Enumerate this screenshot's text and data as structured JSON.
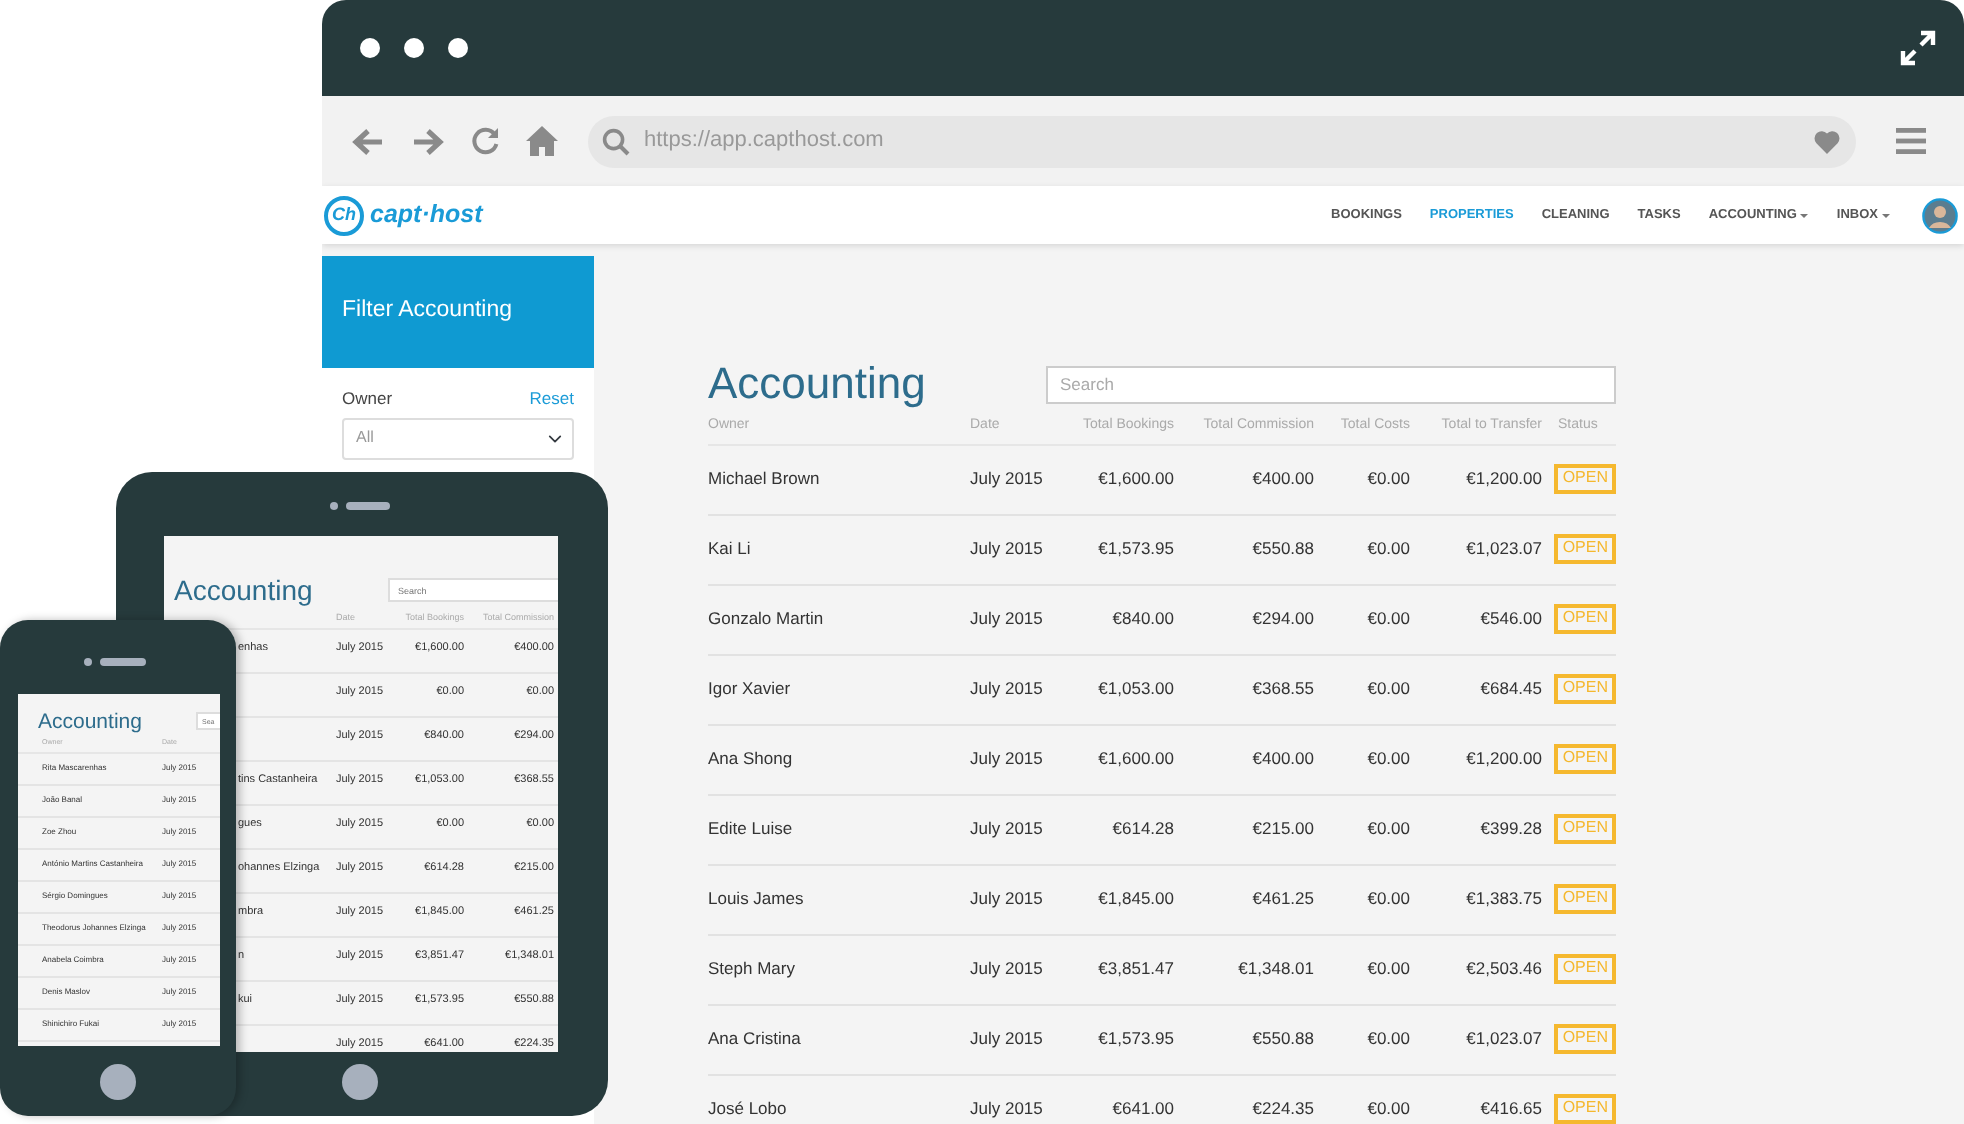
{
  "browser": {
    "url": "https://app.capthost.com"
  },
  "app": {
    "logo_mark": "Ch",
    "logo_text": "capt·host",
    "nav": [
      {
        "label": "BOOKINGS",
        "selected": false,
        "dropdown": false
      },
      {
        "label": "PROPERTIES",
        "selected": true,
        "dropdown": false
      },
      {
        "label": "CLEANING",
        "selected": false,
        "dropdown": false
      },
      {
        "label": "TASKS",
        "selected": false,
        "dropdown": false
      },
      {
        "label": "ACCOUNTING",
        "selected": false,
        "dropdown": true
      },
      {
        "label": "INBOX",
        "selected": false,
        "dropdown": true
      }
    ],
    "sidebar": {
      "title": "Filter Accounting",
      "owner_label": "Owner",
      "reset": "Reset",
      "owner_select": "All"
    },
    "page": {
      "title": "Accounting",
      "search_placeholder": "Search",
      "columns": [
        "Owner",
        "Date",
        "Total Bookings",
        "Total Commission",
        "Total Costs",
        "Total to Transfer",
        "Status"
      ],
      "rows": [
        {
          "owner": "Michael Brown",
          "date": "July 2015",
          "total_bookings": "€1,600.00",
          "total_commission": "€400.00",
          "total_costs": "€0.00",
          "total_to_transfer": "€1,200.00",
          "status": "OPEN"
        },
        {
          "owner": "Kai Li",
          "date": "July 2015",
          "total_bookings": "€1,573.95",
          "total_commission": "€550.88",
          "total_costs": "€0.00",
          "total_to_transfer": "€1,023.07",
          "status": "OPEN"
        },
        {
          "owner": "Gonzalo Martin",
          "date": "July 2015",
          "total_bookings": "€840.00",
          "total_commission": "€294.00",
          "total_costs": "€0.00",
          "total_to_transfer": "€546.00",
          "status": "OPEN"
        },
        {
          "owner": "Igor Xavier",
          "date": "July 2015",
          "total_bookings": "€1,053.00",
          "total_commission": "€368.55",
          "total_costs": "€0.00",
          "total_to_transfer": "€684.45",
          "status": "OPEN"
        },
        {
          "owner": "Ana Shong",
          "date": "July 2015",
          "total_bookings": "€1,600.00",
          "total_commission": "€400.00",
          "total_costs": "€0.00",
          "total_to_transfer": "€1,200.00",
          "status": "OPEN"
        },
        {
          "owner": "Edite Luise",
          "date": "July 2015",
          "total_bookings": "€614.28",
          "total_commission": "€215.00",
          "total_costs": "€0.00",
          "total_to_transfer": "€399.28",
          "status": "OPEN"
        },
        {
          "owner": "Louis James",
          "date": "July 2015",
          "total_bookings": "€1,845.00",
          "total_commission": "€461.25",
          "total_costs": "€0.00",
          "total_to_transfer": "€1,383.75",
          "status": "OPEN"
        },
        {
          "owner": "Steph Mary",
          "date": "July 2015",
          "total_bookings": "€3,851.47",
          "total_commission": "€1,348.01",
          "total_costs": "€0.00",
          "total_to_transfer": "€2,503.46",
          "status": "OPEN"
        },
        {
          "owner": "Ana Cristina",
          "date": "July 2015",
          "total_bookings": "€1,573.95",
          "total_commission": "€550.88",
          "total_costs": "€0.00",
          "total_to_transfer": "€1,023.07",
          "status": "OPEN"
        },
        {
          "owner": "José Lobo",
          "date": "July 2015",
          "total_bookings": "€641.00",
          "total_commission": "€224.35",
          "total_costs": "€0.00",
          "total_to_transfer": "€416.65",
          "status": "OPEN"
        }
      ]
    }
  },
  "tablet": {
    "title": "Accounting",
    "search_placeholder": "Search",
    "columns": [
      "Date",
      "Total Bookings",
      "Total Commission"
    ],
    "rows": [
      {
        "owner": "enhas",
        "date": "July 2015",
        "total_bookings": "€1,600.00",
        "total_commission": "€400.00"
      },
      {
        "date": "July 2015",
        "total_bookings": "€0.00",
        "total_commission": "€0.00"
      },
      {
        "date": "July 2015",
        "total_bookings": "€840.00",
        "total_commission": "€294.00"
      },
      {
        "owner": "tins Castanheira",
        "date": "July 2015",
        "total_bookings": "€1,053.00",
        "total_commission": "€368.55"
      },
      {
        "owner": "gues",
        "date": "July 2015",
        "total_bookings": "€0.00",
        "total_commission": "€0.00"
      },
      {
        "owner": "ohannes Elzinga",
        "date": "July 2015",
        "total_bookings": "€614.28",
        "total_commission": "€215.00"
      },
      {
        "owner": "mbra",
        "date": "July 2015",
        "total_bookings": "€1,845.00",
        "total_commission": "€461.25"
      },
      {
        "owner": "n",
        "date": "July 2015",
        "total_bookings": "€3,851.47",
        "total_commission": "€1,348.01"
      },
      {
        "owner": "kui",
        "date": "July 2015",
        "total_bookings": "€1,573.95",
        "total_commission": "€550.88"
      },
      {
        "date": "July 2015",
        "total_bookings": "€641.00",
        "total_commission": "€224.35"
      }
    ]
  },
  "phone": {
    "title": "Accounting",
    "search_placeholder": "Sea",
    "columns": [
      "Owner",
      "Date"
    ],
    "rows": [
      {
        "owner": "Rita Mascarenhas",
        "date": "July 2015"
      },
      {
        "owner": "João Banal",
        "date": "July 2015"
      },
      {
        "owner": "Zoe Zhou",
        "date": "July 2015"
      },
      {
        "owner": "António Martins Castanheira",
        "date": "July 2015"
      },
      {
        "owner": "Sérgio Domingues",
        "date": "July 2015"
      },
      {
        "owner": "Theodorus Johannes Elzinga",
        "date": "July 2015"
      },
      {
        "owner": "Anabela Coimbra",
        "date": "July 2015"
      },
      {
        "owner": "Denis Maslov",
        "date": "July 2015"
      },
      {
        "owner": "Shinichiro Fukai",
        "date": "July 2015"
      }
    ]
  }
}
